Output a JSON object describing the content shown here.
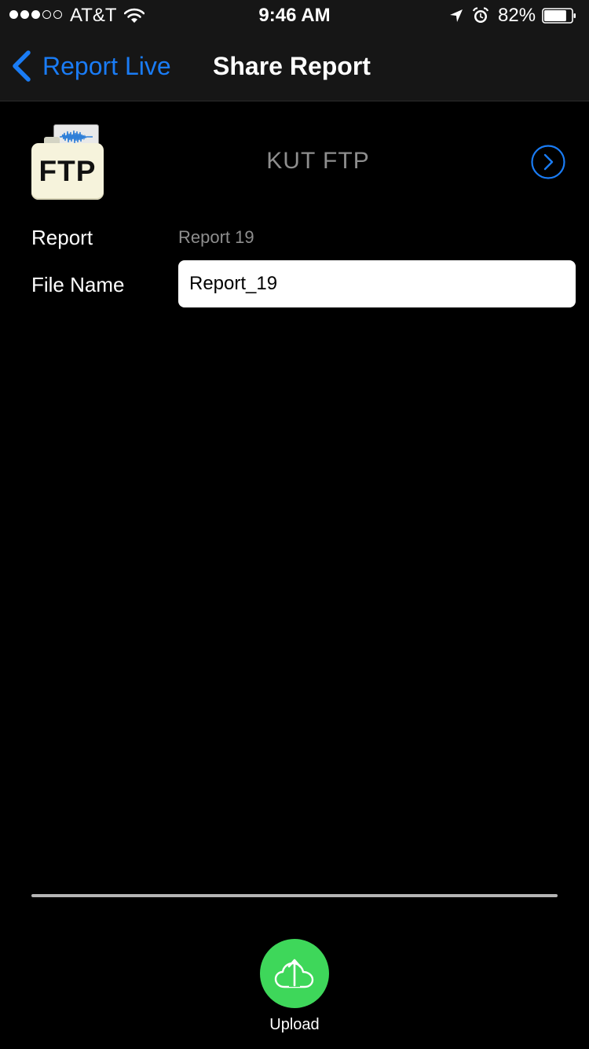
{
  "status_bar": {
    "signal_bars_filled": 3,
    "signal_bars_total": 5,
    "carrier": "AT&T",
    "time": "9:46 AM",
    "battery_percent": "82%",
    "battery_level": 0.82,
    "icons": [
      "wifi-icon",
      "location-arrow-icon",
      "alarm-icon",
      "battery-icon"
    ]
  },
  "nav": {
    "back_label": "Report Live",
    "title": "Share Report",
    "accent_color": "#1a7cf5"
  },
  "service": {
    "logo_text": "FTP",
    "name": "KUT FTP",
    "detail_icon": "chevron-right-circle-icon"
  },
  "form": {
    "report_label": "Report",
    "report_value": "Report 19",
    "file_name_label": "File Name",
    "file_name_value": "Report_19"
  },
  "upload": {
    "progress": 0,
    "label": "Upload",
    "button_color": "#3ed75a",
    "icon": "cloud-upload-icon"
  }
}
